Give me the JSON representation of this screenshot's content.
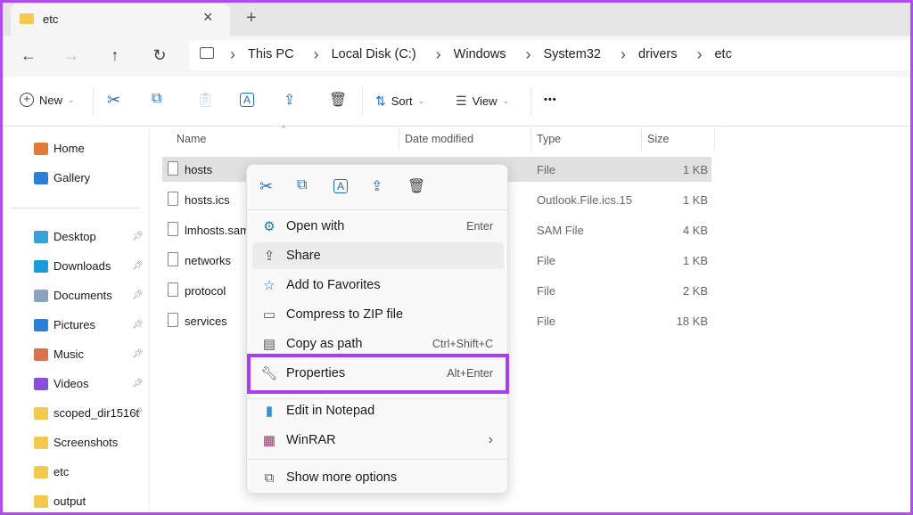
{
  "tab": {
    "title": "etc",
    "close": "×",
    "new": "+"
  },
  "nav": {
    "back": "←",
    "forward": "→",
    "up": "↑",
    "refresh": "↻"
  },
  "breadcrumb": [
    "This PC",
    "Local Disk (C:)",
    "Windows",
    "System32",
    "drivers",
    "etc"
  ],
  "toolbar": {
    "new": "New",
    "sort": "Sort",
    "view": "View",
    "more": "•••"
  },
  "sidebar": {
    "top": [
      {
        "label": "Home",
        "color": "#e07b39"
      },
      {
        "label": "Gallery",
        "color": "#2b7fd6"
      }
    ],
    "items": [
      {
        "label": "Desktop",
        "color": "#3aa0d8",
        "pinned": true
      },
      {
        "label": "Downloads",
        "color": "#1a9ad6",
        "pinned": true
      },
      {
        "label": "Documents",
        "color": "#8aa4c0",
        "pinned": true
      },
      {
        "label": "Pictures",
        "color": "#2b7fd6",
        "pinned": true
      },
      {
        "label": "Music",
        "color": "#d8734f",
        "pinned": true
      },
      {
        "label": "Videos",
        "color": "#8a4fd8",
        "pinned": true
      },
      {
        "label": "scoped_dir1516t",
        "color": "#f2c94c",
        "pinned": true
      },
      {
        "label": "Screenshots",
        "color": "#f2c94c"
      },
      {
        "label": "etc",
        "color": "#f2c94c"
      },
      {
        "label": "output",
        "color": "#f2c94c"
      }
    ]
  },
  "columns": [
    "Name",
    "Date modified",
    "Type",
    "Size"
  ],
  "files": [
    {
      "name": "hosts",
      "type": "File",
      "size": "1 KB",
      "selected": true
    },
    {
      "name": "hosts.ics",
      "type": "Outlook.File.ics.15",
      "size": "1 KB"
    },
    {
      "name": "lmhosts.sam",
      "type": "SAM File",
      "size": "4 KB"
    },
    {
      "name": "networks",
      "type": "File",
      "size": "1 KB"
    },
    {
      "name": "protocol",
      "type": "File",
      "size": "2 KB"
    },
    {
      "name": "services",
      "type": "File",
      "size": "18 KB"
    }
  ],
  "context_menu": {
    "items": [
      {
        "label": "Open with",
        "shortcut": "Enter",
        "icon": "open-with-icon"
      },
      {
        "label": "Share",
        "icon": "share-icon"
      },
      {
        "label": "Add to Favorites",
        "icon": "star-icon"
      },
      {
        "label": "Compress to ZIP file",
        "icon": "zip-icon"
      },
      {
        "label": "Copy as path",
        "shortcut": "Ctrl+Shift+C",
        "icon": "copy-path-icon"
      },
      {
        "label": "Properties",
        "shortcut": "Alt+Enter",
        "icon": "wrench-icon"
      },
      {
        "label": "Edit in Notepad",
        "icon": "notepad-icon"
      },
      {
        "label": "WinRAR",
        "icon": "winrar-icon",
        "submenu": "›"
      },
      {
        "label": "Show more options",
        "icon": "more-options-icon"
      }
    ]
  },
  "highlight_color": "#a83cf0"
}
